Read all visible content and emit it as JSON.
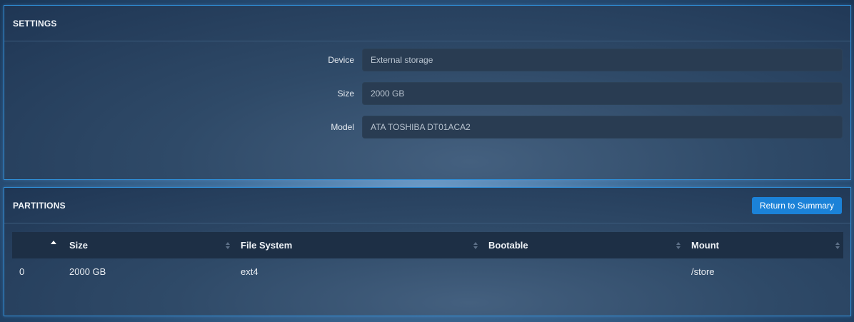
{
  "settings": {
    "title": "SETTINGS",
    "fields": [
      {
        "label": "Device",
        "value": "External storage"
      },
      {
        "label": "Size",
        "value": "2000 GB"
      },
      {
        "label": "Model",
        "value": "ATA TOSHIBA DT01ACA2"
      }
    ]
  },
  "partitions": {
    "title": "PARTITIONS",
    "return_label": "Return to Summary",
    "columns": [
      "",
      "Size",
      "File System",
      "Bootable",
      "Mount"
    ],
    "rows": [
      {
        "index": "0",
        "size": "2000 GB",
        "file_system": "ext4",
        "bootable": "",
        "mount": "/store"
      }
    ]
  },
  "colors": {
    "accent": "#1b82d8",
    "panel_border": "#2f8fd8",
    "table_header": "#1d2f45"
  }
}
